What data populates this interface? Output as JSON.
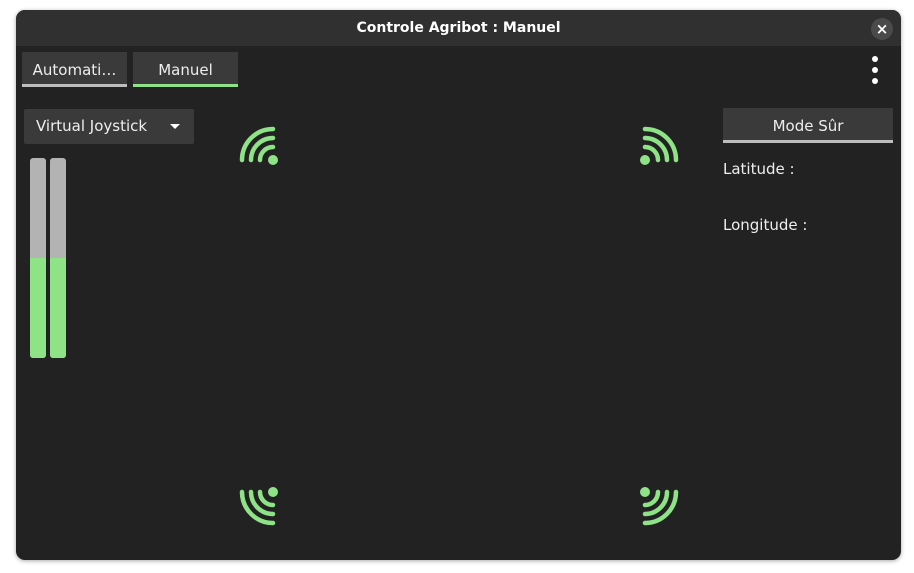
{
  "window": {
    "title": "Controle Agribot : Manuel",
    "close_icon": "×"
  },
  "tabs": [
    {
      "label": "Automati…",
      "active": false
    },
    {
      "label": "Manuel",
      "active": true
    }
  ],
  "menu": {
    "icon": "vertical-dots-icon"
  },
  "controller_select": {
    "value": "Virtual Joystick"
  },
  "gauges": [
    {
      "name": "left",
      "level_percent": 50
    },
    {
      "name": "right",
      "level_percent": 50
    }
  ],
  "signal_icons": [
    "wifi-top-left-icon",
    "wifi-top-right-icon",
    "wifi-bottom-left-icon",
    "wifi-bottom-right-icon"
  ],
  "side_panel": {
    "mode_button": "Mode Sûr",
    "latitude_label": "Latitude :",
    "longitude_label": "Longitude :"
  },
  "colors": {
    "accent_green": "#8fe387",
    "background": "#222222",
    "surface": "#3a3a3a"
  }
}
